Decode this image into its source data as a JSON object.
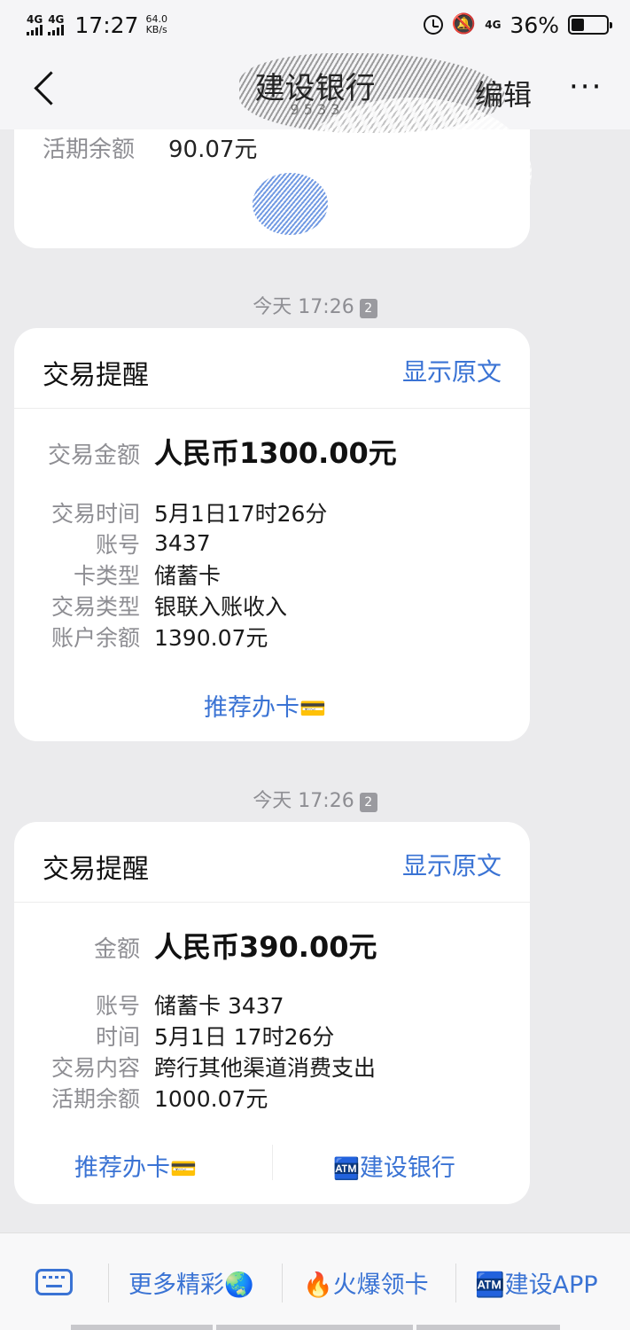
{
  "status_bar": {
    "signal1": "4G",
    "signal2": "4G",
    "time": "17:27",
    "net_speed_value": "64.0",
    "net_speed_unit": "KB/s",
    "data_4g": "4G",
    "battery_percent": "36%",
    "battery_level": 0.36
  },
  "header": {
    "title": "建设银行",
    "subtitle": "9 5 3 3",
    "edit_label": "编辑",
    "more_label": "···"
  },
  "top_message": {
    "label": "活期余额",
    "value": "90.07元"
  },
  "messages": [
    {
      "timestamp": "今天 17:26",
      "sim_badge": "2",
      "title": "交易提醒",
      "show_original": "显示原文",
      "amount_label": "交易金额",
      "amount_value": "人民币1300.00元",
      "details": [
        {
          "label": "交易时间",
          "value": "5月1日17时26分"
        },
        {
          "label": "账号",
          "value": "3437"
        },
        {
          "label": "卡类型",
          "value": "储蓄卡"
        },
        {
          "label": "交易类型",
          "value": "银联入账收入"
        },
        {
          "label": "账户余额",
          "value": "1390.07元"
        }
      ],
      "actions": [
        {
          "label": "推荐办卡",
          "icon": "💳"
        }
      ]
    },
    {
      "timestamp": "今天 17:26",
      "sim_badge": "2",
      "title": "交易提醒",
      "show_original": "显示原文",
      "amount_label": "金额",
      "amount_value": "人民币390.00元",
      "details": [
        {
          "label": "账号",
          "value": "储蓄卡 3437"
        },
        {
          "label": "时间",
          "value": "5月1日 17时26分"
        },
        {
          "label": "交易内容",
          "value": "跨行其他渠道消费支出"
        },
        {
          "label": "活期余额",
          "value": "1000.07元"
        }
      ],
      "actions": [
        {
          "label": "推荐办卡",
          "icon": "💳"
        },
        {
          "label": "建设银行",
          "icon": "🏧"
        }
      ]
    }
  ],
  "bottom_bar": {
    "items": [
      {
        "label": "更多精彩",
        "icon": "🌏"
      },
      {
        "label": "火爆领卡",
        "icon": "🔥"
      },
      {
        "label": "建设APP",
        "icon": "🏧"
      }
    ]
  },
  "colors": {
    "link_blue": "#3a73d4",
    "label_gray": "#8e8e93",
    "background": "#ebebed"
  }
}
